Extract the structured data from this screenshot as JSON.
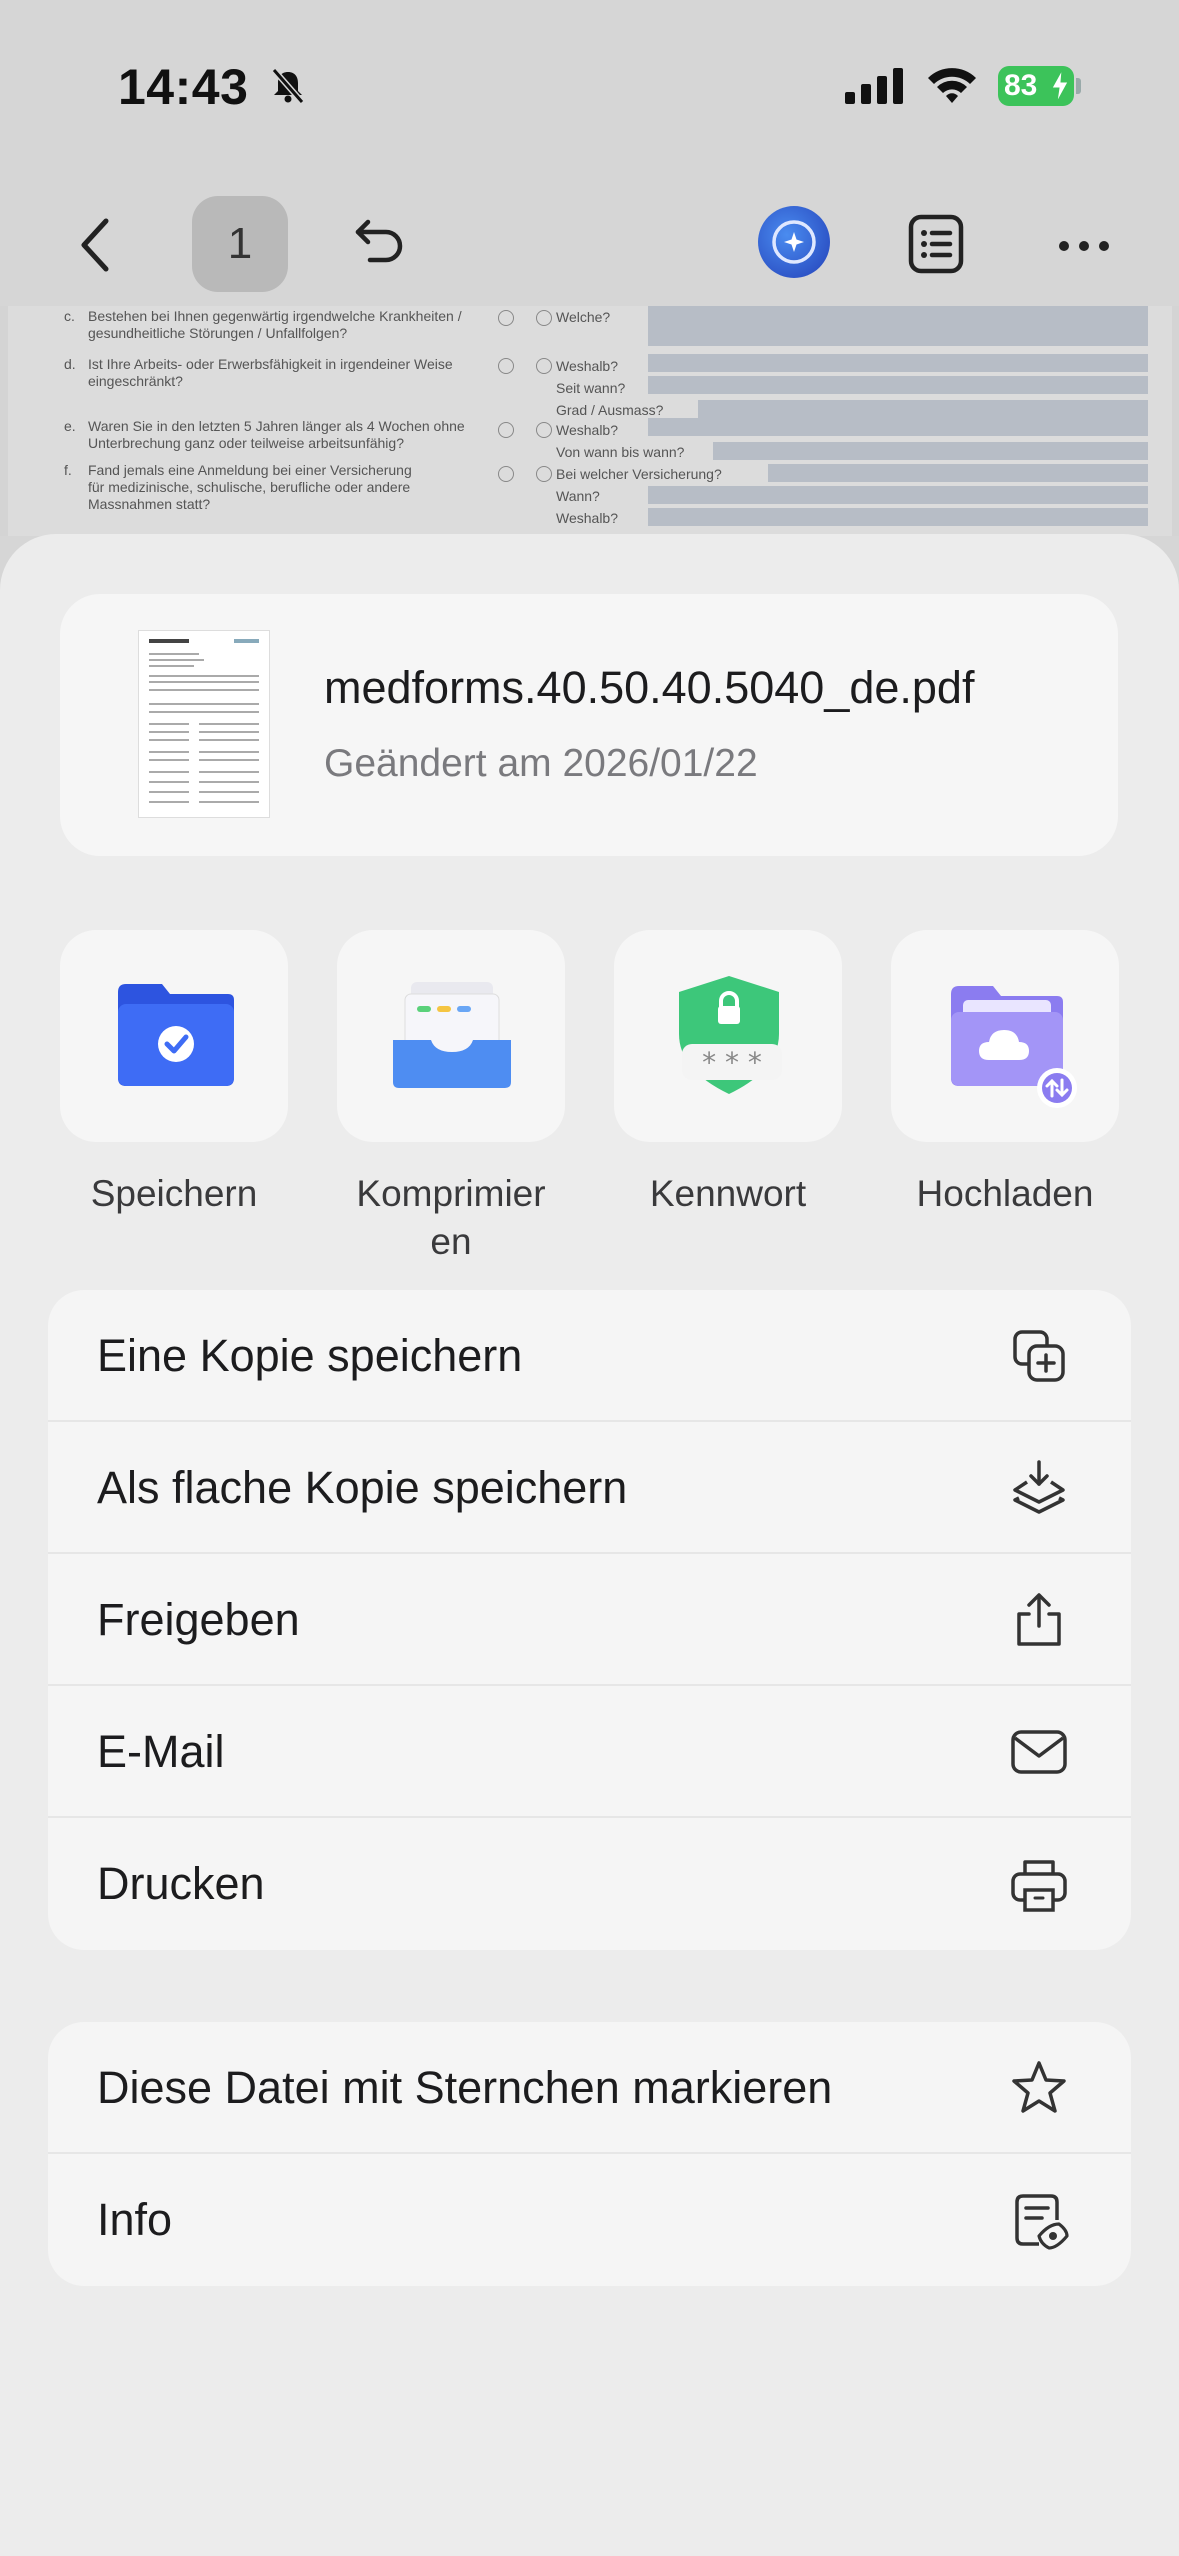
{
  "status_bar": {
    "time": "14:43",
    "battery": "83"
  },
  "toolbar": {
    "page_number": "1"
  },
  "document_preview": {
    "rows": [
      {
        "letter": "c.",
        "question": "Bestehen bei Ihnen gegenwärtig irgendwelche Krankheiten / gesundheitliche Störungen / Unfallfolgen?",
        "answers": [
          "Welche?"
        ]
      },
      {
        "letter": "d.",
        "question": "Ist Ihre Arbeits- oder Erwerbsfähigkeit in irgendeiner Weise eingeschränkt?",
        "answers": [
          "Weshalb?",
          "Seit wann?",
          "Grad / Ausmass?"
        ]
      },
      {
        "letter": "e.",
        "question": "Waren Sie in den letzten 5 Jahren länger als 4 Wochen ohne Unterbrechung ganz oder teilweise arbeitsunfähig?",
        "answers": [
          "Weshalb?",
          "Von wann bis wann?"
        ]
      },
      {
        "letter": "f.",
        "question": "Fand jemals eine Anmeldung bei einer Versicherung für medizinische, schulische, berufliche oder andere Massnahmen statt?",
        "answers": [
          "Bei welcher Versicherung?",
          "Wann?",
          "Weshalb?"
        ]
      }
    ]
  },
  "file": {
    "name": "medforms.40.50.40.5040_de.pdf",
    "modified": "Geändert am 2026/01/22"
  },
  "quick_actions": [
    {
      "label": "Speichern",
      "icon": "folder-check-icon"
    },
    {
      "label": "Komprimier\nen",
      "icon": "compress-tray-icon"
    },
    {
      "label": "Kennwort",
      "icon": "password-shield-icon"
    },
    {
      "label": "Hochladen",
      "icon": "cloud-upload-folder-icon"
    }
  ],
  "menu_group_1": [
    {
      "label": "Eine Kopie speichern",
      "icon": "copy-add-icon"
    },
    {
      "label": "Als flache Kopie speichern",
      "icon": "flatten-download-icon"
    },
    {
      "label": "Freigeben",
      "icon": "share-icon"
    },
    {
      "label": "E-Mail",
      "icon": "mail-icon"
    },
    {
      "label": "Drucken",
      "icon": "printer-icon"
    }
  ],
  "menu_group_2": [
    {
      "label": "Diese Datei mit Sternchen markieren",
      "icon": "star-icon"
    },
    {
      "label": "Info",
      "icon": "info-doc-icon"
    }
  ]
}
